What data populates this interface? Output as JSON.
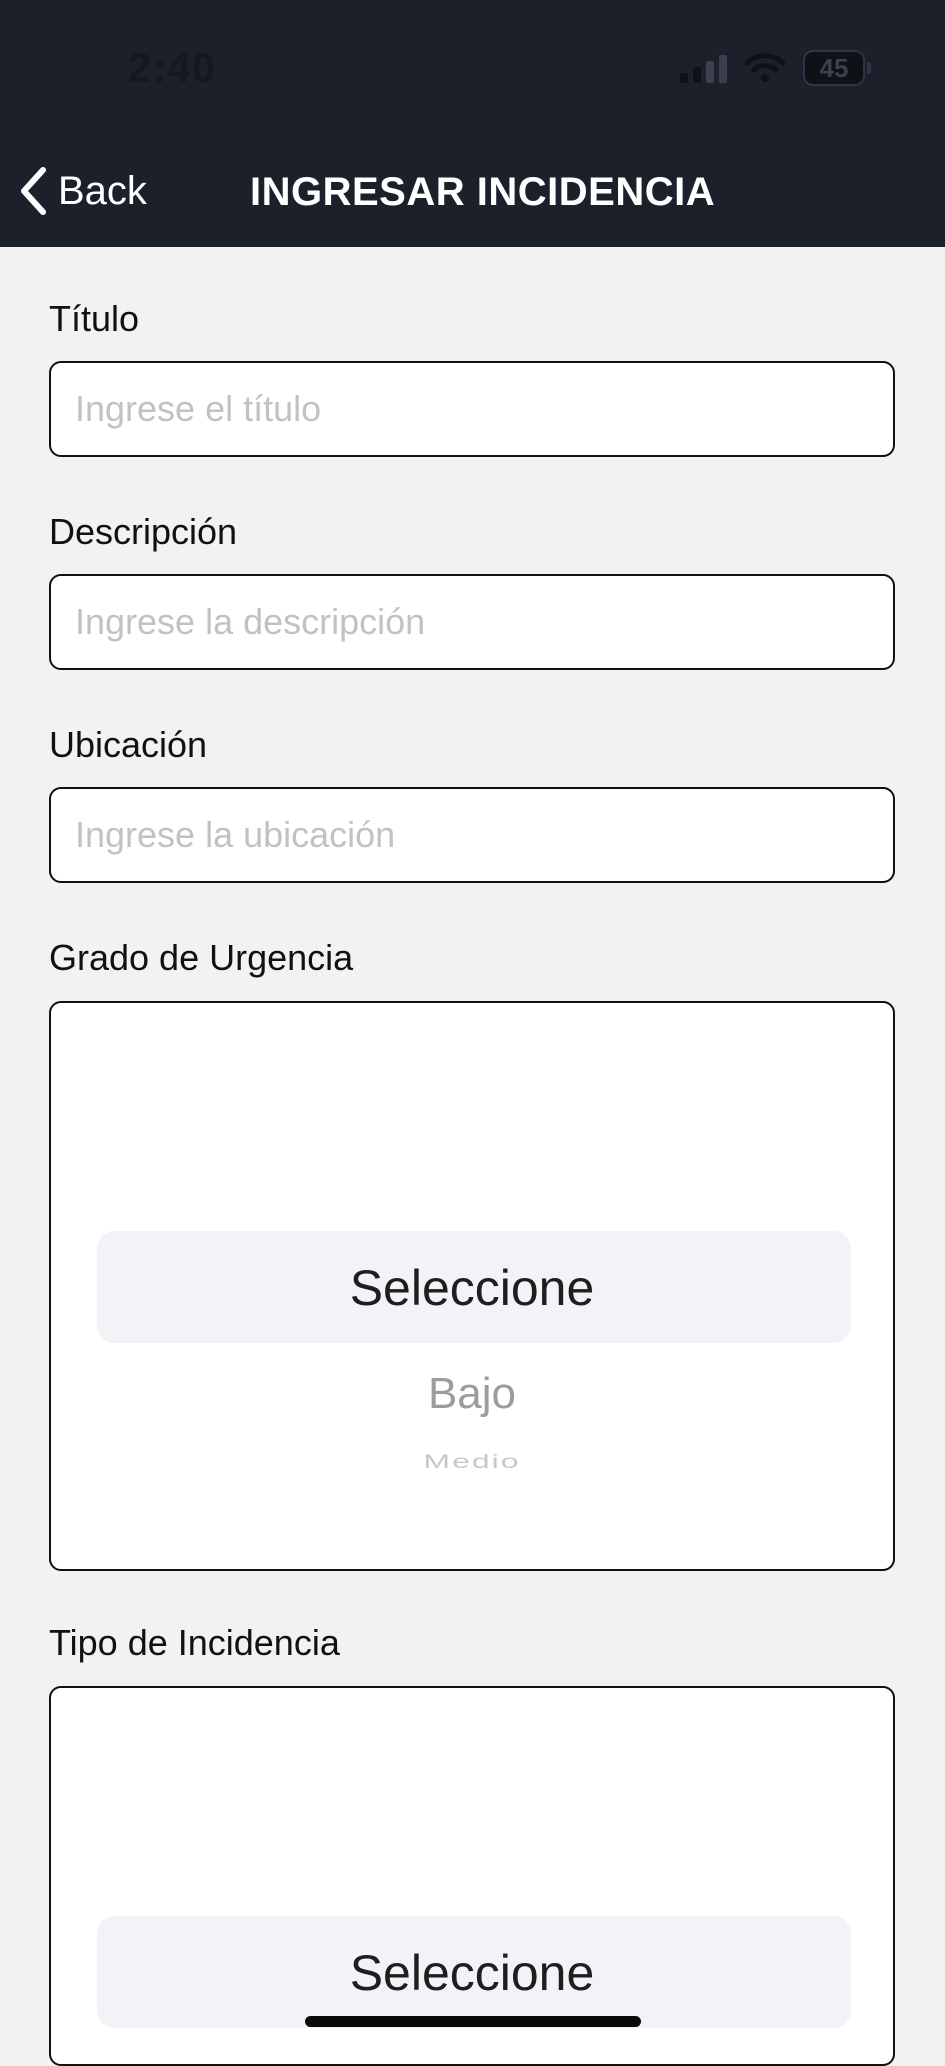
{
  "status_bar": {
    "time": "2:40",
    "battery": "45"
  },
  "nav": {
    "back_label": "Back",
    "title": "INGRESAR INCIDENCIA"
  },
  "form": {
    "titulo": {
      "label": "Título",
      "placeholder": "Ingrese el título",
      "value": ""
    },
    "descripcion": {
      "label": "Descripción",
      "placeholder": "Ingrese la descripción",
      "value": ""
    },
    "ubicacion": {
      "label": "Ubicación",
      "placeholder": "Ingrese la ubicación",
      "value": ""
    },
    "urgencia": {
      "label": "Grado de Urgencia",
      "selected": "Seleccione",
      "options": [
        "Bajo",
        "Medio"
      ]
    },
    "tipo": {
      "label": "Tipo de Incidencia",
      "selected": "Seleccione"
    }
  },
  "colors": {
    "header_bg": "#1b202b",
    "page_bg": "#f2f2f2",
    "picker_highlight": "#f2f2f7"
  },
  "icons": {
    "back": "chevron-left-icon",
    "signal": "cellular-signal-icon",
    "wifi": "wifi-icon",
    "battery": "battery-icon"
  }
}
